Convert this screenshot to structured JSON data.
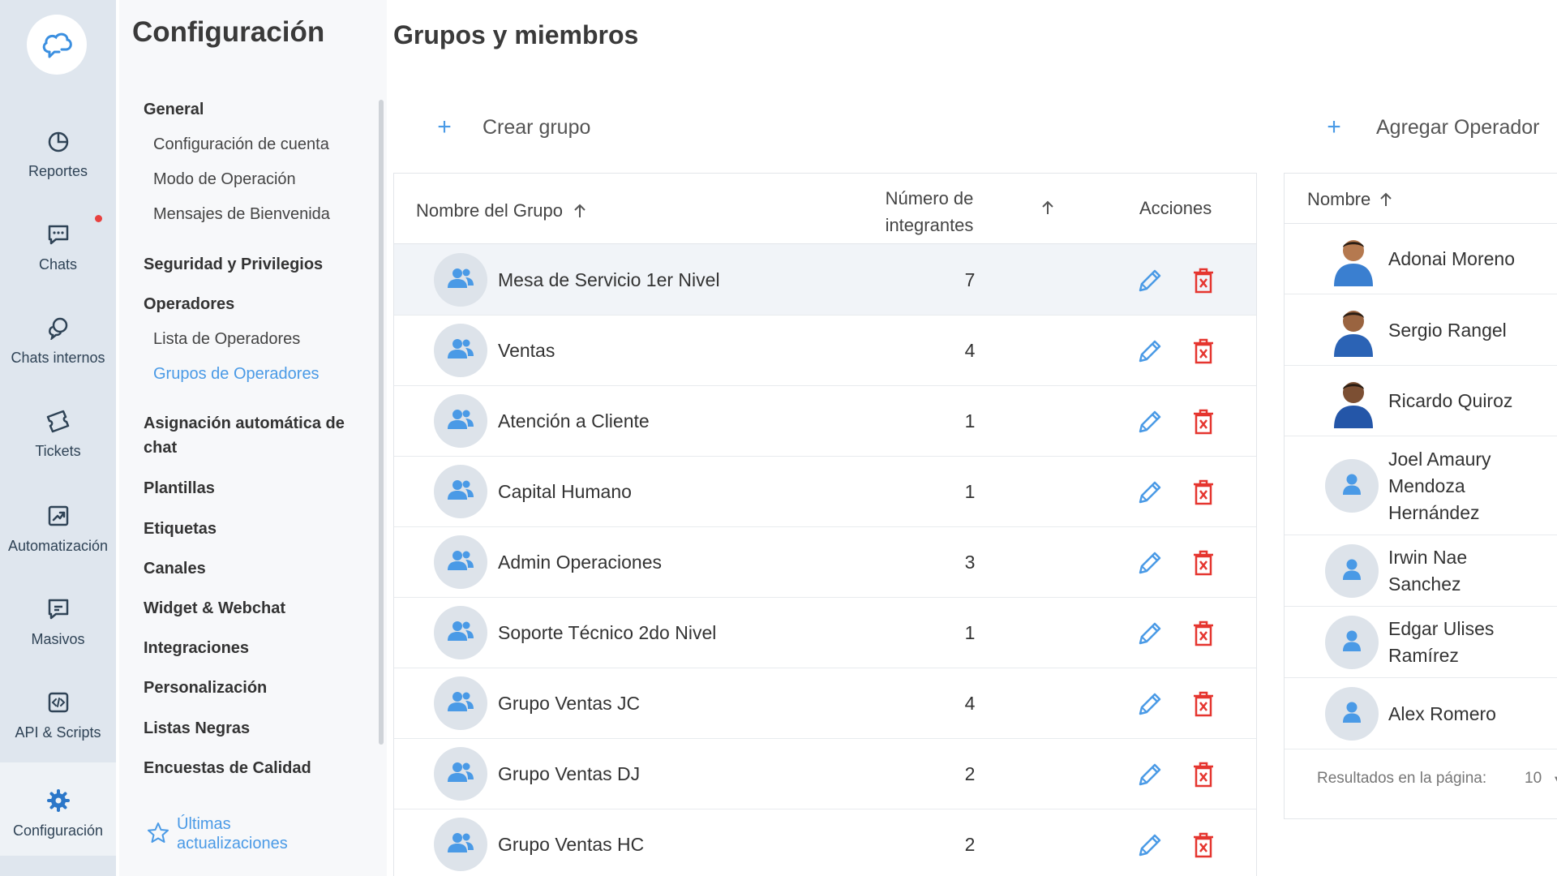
{
  "rail": {
    "items": [
      {
        "label": "Reportes",
        "icon": "pie-chart-icon"
      },
      {
        "label": "Chats",
        "icon": "chat-bubble-icon"
      },
      {
        "label": "Chats internos",
        "icon": "internal-chat-icon"
      },
      {
        "label": "Tickets",
        "icon": "ticket-icon"
      },
      {
        "label": "Automatización",
        "icon": "automation-icon"
      },
      {
        "label": "Masivos",
        "icon": "broadcast-icon"
      },
      {
        "label": "API & Scripts",
        "icon": "code-icon"
      },
      {
        "label": "Configuración",
        "icon": "gear-icon"
      }
    ]
  },
  "settings": {
    "title": "Configuración",
    "general": "General",
    "config_cuenta": "Configuración de cuenta",
    "modo_operacion": "Modo de Operación",
    "mensajes_bienvenida": "Mensajes de Bienvenida",
    "seguridad": "Seguridad y Privilegios",
    "operadores": "Operadores",
    "lista_operadores": "Lista de Operadores",
    "grupos_operadores": "Grupos de Operadores",
    "asignacion": "Asignación automática de chat",
    "plantillas": "Plantillas",
    "etiquetas": "Etiquetas",
    "canales": "Canales",
    "widget": "Widget & Webchat",
    "integraciones": "Integraciones",
    "personalizacion": "Personalización",
    "listas_negras": "Listas Negras",
    "encuestas": "Encuestas de Calidad",
    "updates": "Últimas actualizaciones"
  },
  "main": {
    "title": "Grupos y miembros",
    "create_group": "Crear grupo",
    "add_operator": "Agregar Operador"
  },
  "groups_table": {
    "col_name": "Nombre del Grupo",
    "col_count_line1": "Número de",
    "col_count_line2": "integrantes",
    "col_actions": "Acciones",
    "rows": [
      {
        "name": "Mesa de Servicio 1er Nivel",
        "count": "7"
      },
      {
        "name": "Ventas",
        "count": "4"
      },
      {
        "name": "Atención a Cliente",
        "count": "1"
      },
      {
        "name": "Capital Humano",
        "count": "1"
      },
      {
        "name": "Admin Operaciones",
        "count": "3"
      },
      {
        "name": "Soporte Técnico 2do Nivel",
        "count": "1"
      },
      {
        "name": "Grupo Ventas JC",
        "count": "4"
      },
      {
        "name": "Grupo Ventas DJ",
        "count": "2"
      },
      {
        "name": "Grupo Ventas HC",
        "count": "2"
      }
    ]
  },
  "operators_table": {
    "col_name": "Nombre",
    "rows": [
      {
        "name": "Adonai Moreno"
      },
      {
        "name": "Sergio Rangel"
      },
      {
        "name": "Ricardo Quiroz"
      },
      {
        "name": "Joel Amaury Mendoza Hernández"
      },
      {
        "name": "Irwin Nae Sanchez"
      },
      {
        "name": "Edgar Ulises Ramírez"
      },
      {
        "name": "Alex Romero"
      }
    ],
    "results_label": "Resultados en la página:",
    "per_page": "10"
  },
  "colors": {
    "accent": "#4a9ae6",
    "delete": "#e5352f",
    "rail_bg": "#dfe6ee",
    "icon_dark": "#2f4356"
  }
}
